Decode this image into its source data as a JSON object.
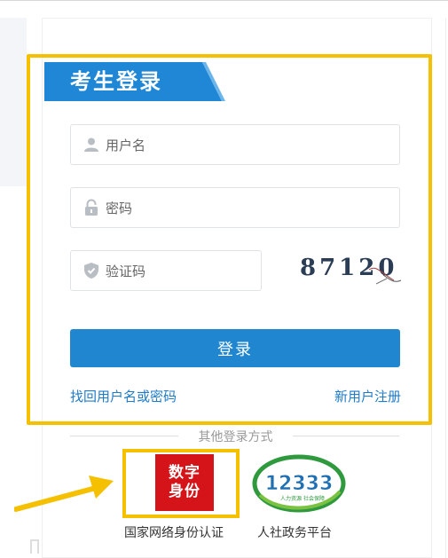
{
  "login": {
    "title": "考生登录",
    "username_placeholder": "用户名",
    "password_placeholder": "密码",
    "captcha_placeholder": "验证码",
    "captcha_text": "87120",
    "submit_label": "登录",
    "forgot_link": "找回用户名或密码",
    "register_link": "新用户注册"
  },
  "other_login": {
    "label": "其他登录方式",
    "digital_id": {
      "logo_line1": "数字",
      "logo_line2": "身份",
      "caption": "国家网络身份认证"
    },
    "hrss": {
      "logo_number": "12333",
      "logo_sub": "人力资源 社会保障",
      "caption": "人社政务平台"
    }
  },
  "colors": {
    "primary": "#1f86cf",
    "highlight": "#f5c000",
    "digital_red": "#d51419",
    "hrss_green": "#2f9a3d"
  },
  "icons": {
    "username": "user-icon",
    "password": "lock-icon",
    "captcha": "shield-icon",
    "annotation": "arrow-icon"
  }
}
